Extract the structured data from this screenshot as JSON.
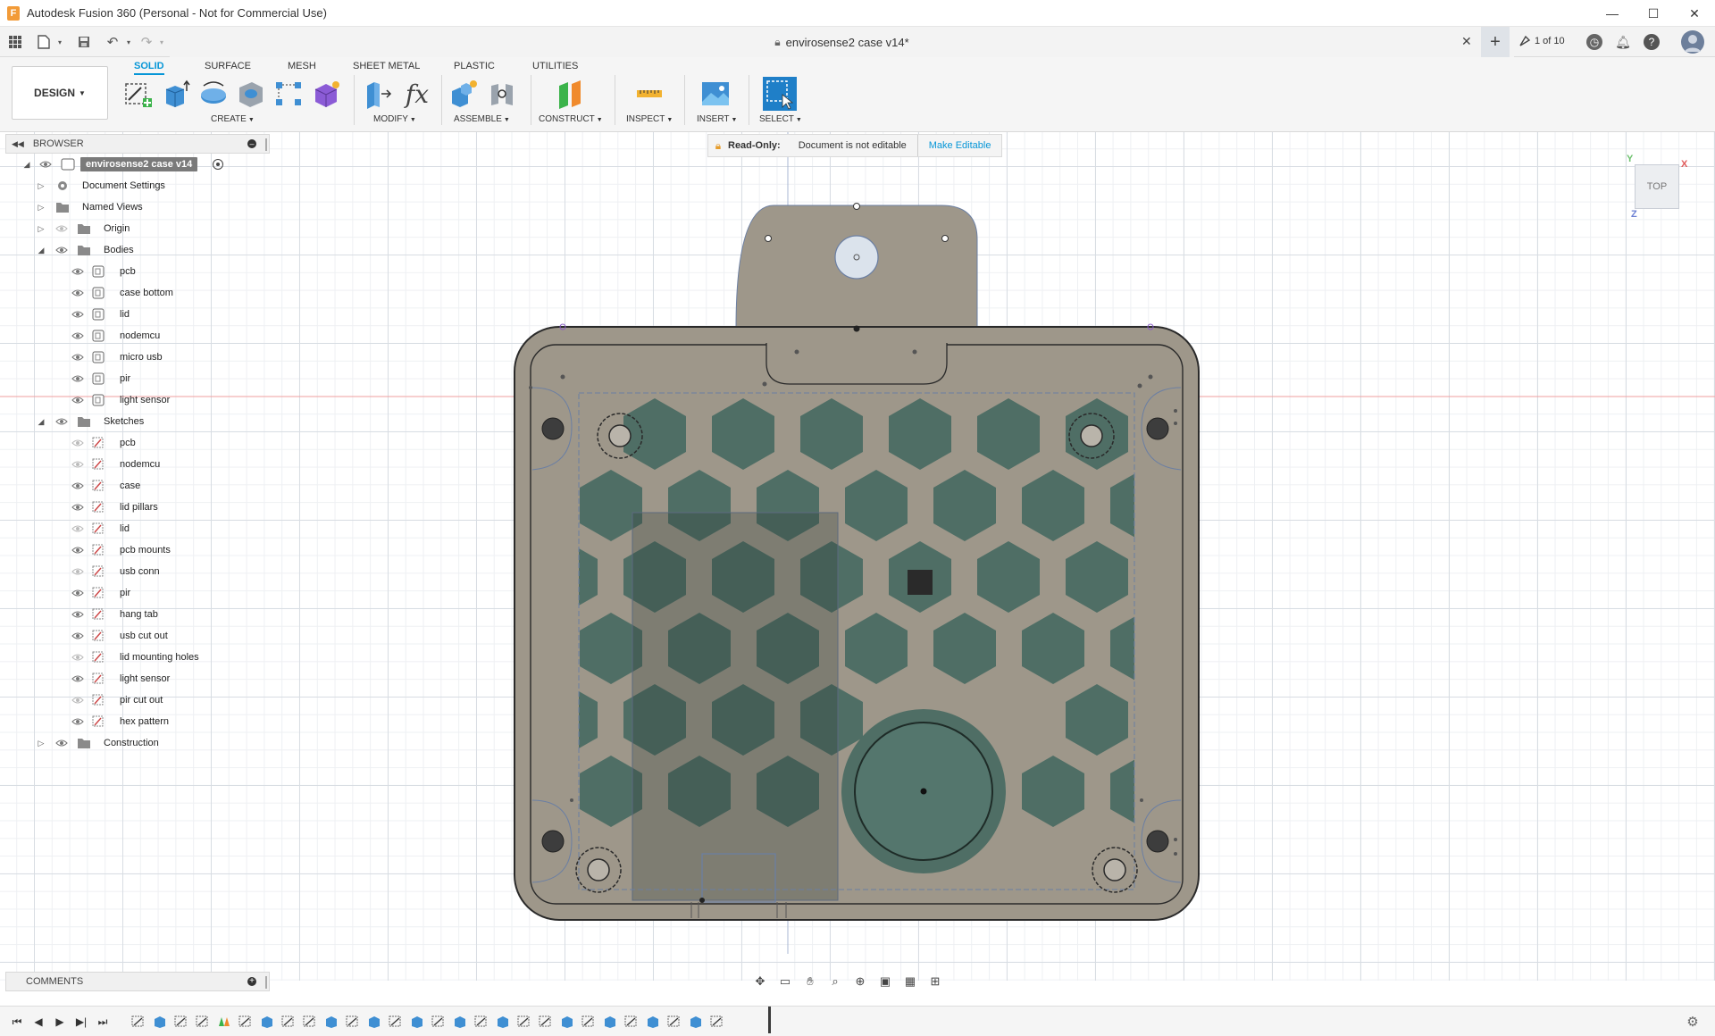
{
  "app": {
    "logo_letter": "F",
    "window_title": "Autodesk Fusion 360 (Personal - Not for Commercial Use)",
    "window_controls": [
      "—",
      "☐",
      "✕"
    ]
  },
  "quick_access": {
    "icons": [
      "grid-icon",
      "file-icon",
      "save-icon",
      "undo-icon",
      "redo-icon"
    ]
  },
  "document_tab": {
    "title": "envirosense2 case v14*",
    "close": "✕",
    "new_tab": "+"
  },
  "job_status": {
    "label": "1 of 10"
  },
  "ribbon": {
    "workspace": "DESIGN",
    "tabs": [
      {
        "label": "SOLID",
        "active": true
      },
      {
        "label": "SURFACE"
      },
      {
        "label": "MESH"
      },
      {
        "label": "SHEET METAL"
      },
      {
        "label": "PLASTIC"
      },
      {
        "label": "UTILITIES"
      }
    ],
    "groups": {
      "create": "CREATE",
      "modify": "MODIFY",
      "assemble": "ASSEMBLE",
      "construct": "CONSTRUCT",
      "inspect": "INSPECT",
      "insert": "INSERT",
      "select": "SELECT"
    },
    "modify_fx": "fx"
  },
  "readonly_banner": {
    "title": "Read-Only:",
    "message": "Document is not editable",
    "action": "Make Editable"
  },
  "viewcube": {
    "face": "TOP",
    "axis_x": "X",
    "axis_y": "Y",
    "axis_z": "Z"
  },
  "browser": {
    "header": "BROWSER",
    "root": "envirosense2 case v14",
    "nodes": {
      "document_settings": "Document Settings",
      "named_views": "Named Views",
      "origin": "Origin",
      "bodies": "Bodies",
      "sketches": "Sketches",
      "construction": "Construction"
    },
    "bodies": [
      "pcb",
      "case bottom",
      "lid",
      "nodemcu",
      "micro usb",
      "pir",
      "light sensor"
    ],
    "sketches": [
      "pcb",
      "nodemcu",
      "case",
      "lid pillars",
      "lid",
      "pcb mounts",
      "usb conn",
      "pir",
      "hang tab",
      "usb cut out",
      "lid mounting holes",
      "light sensor",
      "pir cut out",
      "hex pattern"
    ]
  },
  "comments": {
    "label": "COMMENTS"
  },
  "colors": {
    "accent": "#0696d7",
    "case_body": "#9e978a",
    "hex_cells": "#4f6e65",
    "sketch_line": "#6b7fa3"
  }
}
